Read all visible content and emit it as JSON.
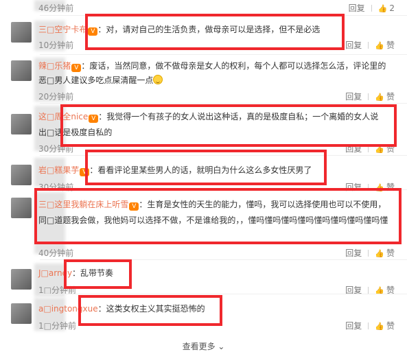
{
  "colors": {
    "username": "#eb7350",
    "redbox": "#f0282d",
    "time": "#8a8a8a"
  },
  "actions": {
    "reply": "回复",
    "like": "赞"
  },
  "more_label": "查看更多 ⌄",
  "comments": [
    {
      "user": "",
      "text": "",
      "time": "46分钟前",
      "like_count": "2"
    },
    {
      "user": "三□空宁卡布",
      "text": "：对，请对自己的生活负责，做母亲可以是选择，但不是必选",
      "time": "10分钟前",
      "like_count": ""
    },
    {
      "user": "辣□乐猪",
      "text": "：废话，当然同意，做不做母亲是女人的权利，每个人都可以选择怎么活，评论里的",
      "text2": "恶□男人建议多吃点屎清醒一点",
      "time": "20分钟前",
      "like_count": ""
    },
    {
      "user": "这□周全nice",
      "text": "：我觉得一个有孩子的女人说出这种话，真的是极度自私；一个离婚的女人说",
      "text2": "出□话是极度自私的",
      "time": "30分钟前",
      "like_count": ""
    },
    {
      "user": "岩□糕果芋",
      "text": "：看看评论里某些男人的话，就明白为什么这么多女性厌男了",
      "time": "30分钟前",
      "like_count": ""
    },
    {
      "user": "三□这里我躺在床上听雪",
      "text": "：生育是女性的天生的能力，懂吗，我可以选择使用也可以不使用，",
      "text2": "同□道题我会做，我他妈可以选择不做，不是谁给我的，，懂吗懂吗懂吗懂吗懂吗懂吗懂吗懂吗懂",
      "time": "40分钟前",
      "like_count": ""
    },
    {
      "user": "J□arney",
      "text": "：乱带节奏",
      "time": "1□分钟前",
      "like_count": ""
    },
    {
      "user": "a□ingtongxue",
      "text": "：这类女权主义其实挺恐怖的",
      "time": "1□分钟前",
      "like_count": ""
    }
  ]
}
